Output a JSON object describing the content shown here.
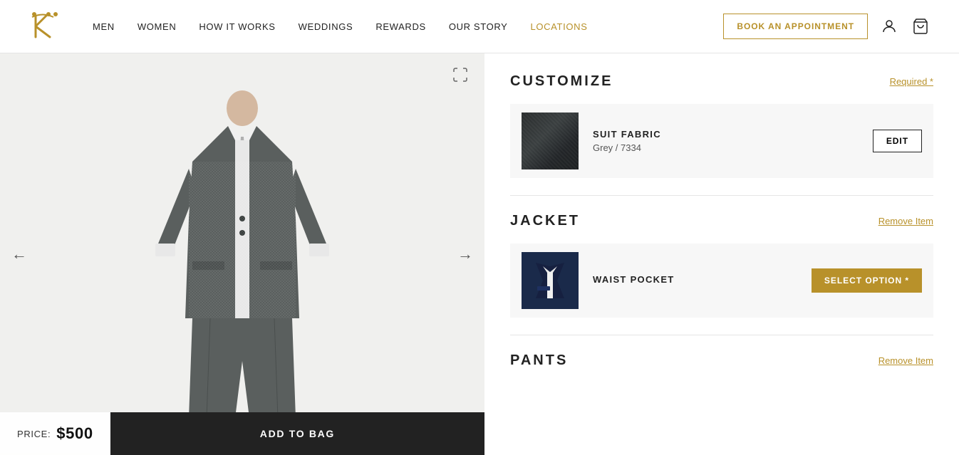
{
  "brand": {
    "logo_text": "K",
    "logo_alt": "Knot Standard"
  },
  "nav": {
    "links": [
      {
        "label": "MEN",
        "url": "#",
        "gold": false
      },
      {
        "label": "WOMEN",
        "url": "#",
        "gold": false
      },
      {
        "label": "HOW IT WORKS",
        "url": "#",
        "gold": false
      },
      {
        "label": "WEDDINGS",
        "url": "#",
        "gold": false
      },
      {
        "label": "REWARDS",
        "url": "#",
        "gold": false
      },
      {
        "label": "OUR STORY",
        "url": "#",
        "gold": false
      },
      {
        "label": "LOCATIONS",
        "url": "#",
        "gold": true
      }
    ],
    "book_btn": "BOOK AN APPOINTMENT"
  },
  "product": {
    "price_label": "PRICE:",
    "price": "$500",
    "add_to_bag": "ADD TO BAG"
  },
  "customize": {
    "title": "CUSTOMIZE",
    "required_label": "Required *",
    "suit_fabric": {
      "name": "SUIT FABRIC",
      "value": "Grey / 7334",
      "edit_btn": "EDIT"
    }
  },
  "jacket": {
    "title": "JACKET",
    "remove_label": "Remove Item",
    "waist_pocket": {
      "name": "WAIST POCKET",
      "select_btn": "SELECT OPTION *"
    }
  },
  "pants": {
    "title": "PANTS",
    "remove_label": "Remove Item"
  },
  "icons": {
    "expand": "⊞",
    "arrow_left": "←",
    "arrow_right": "→",
    "user": "👤",
    "bag": "🛍"
  }
}
